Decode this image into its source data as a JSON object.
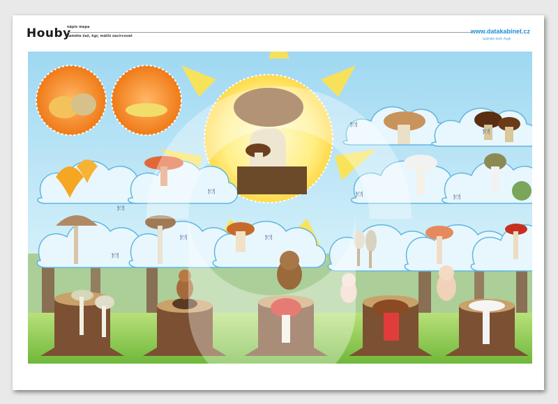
{
  "header": {
    "title": "Houby",
    "sub_top": "nápis mapa",
    "sub_bottom": "zaměte žaž, kgr, mátiš zacírcovat",
    "brand_prefix": "www.data",
    "brand_accent": "kabinet",
    "brand_suffix": ".cz",
    "tagline": "zajímáte Svět, Anglí"
  },
  "colors": {
    "sky": "#bfe6f7",
    "accent_pink": "#ee2a7b",
    "sun": "#ffe76b",
    "grass": "#8fcf4a",
    "brand": "#1f8fd6"
  },
  "icons": {
    "edible": "plate-cutlery-icon",
    "poison": "skull-icon"
  },
  "scene": {
    "answer_boxes": 5
  }
}
